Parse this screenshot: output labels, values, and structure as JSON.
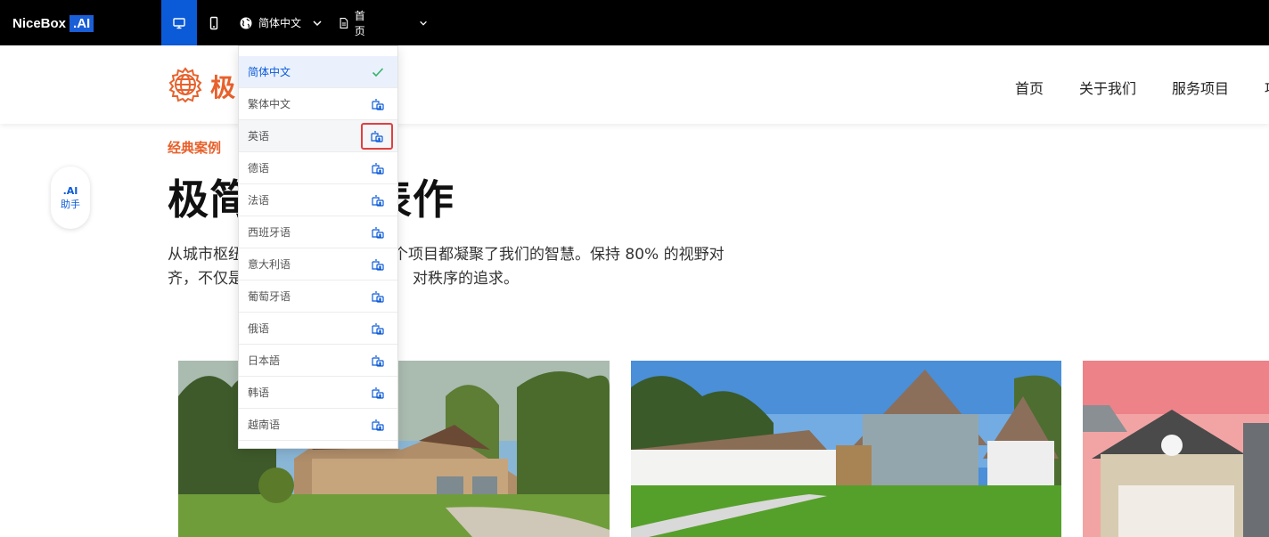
{
  "toolbar": {
    "brand_name": "NiceBox",
    "brand_ai": ".AI",
    "language_label": "简体中文",
    "page_label": "首页"
  },
  "site": {
    "logo_text": "极",
    "nav": [
      "首页",
      "关于我们",
      "服务项目",
      "项"
    ]
  },
  "section": {
    "eyebrow": "经典案例",
    "headline_left": "极简",
    "headline_right": "表作",
    "description_line1_left": "从城市枢纽",
    "description_line1_right": "个项目都凝聚了我们的智慧。保持 80% 的视野对",
    "description_line2_left": "齐，不仅是",
    "description_line2_right": "对秩序的追求。"
  },
  "ai_helper": {
    "tag": ".AI",
    "label": "助手"
  },
  "language_menu": {
    "items": [
      {
        "label": "简体中文",
        "selected": true
      },
      {
        "label": "繁体中文",
        "selected": false
      },
      {
        "label": "英语",
        "selected": false,
        "highlighted_action": true
      },
      {
        "label": "德语",
        "selected": false
      },
      {
        "label": "法语",
        "selected": false
      },
      {
        "label": "西班牙语",
        "selected": false
      },
      {
        "label": "意大利语",
        "selected": false
      },
      {
        "label": "葡萄牙语",
        "selected": false
      },
      {
        "label": "俄语",
        "selected": false
      },
      {
        "label": "日本語",
        "selected": false
      },
      {
        "label": "韩语",
        "selected": false
      },
      {
        "label": "越南语",
        "selected": false
      }
    ]
  },
  "colors": {
    "accent_blue": "#0b5ad8",
    "brand_orange": "#e8612c",
    "highlight_red": "#e04040"
  }
}
